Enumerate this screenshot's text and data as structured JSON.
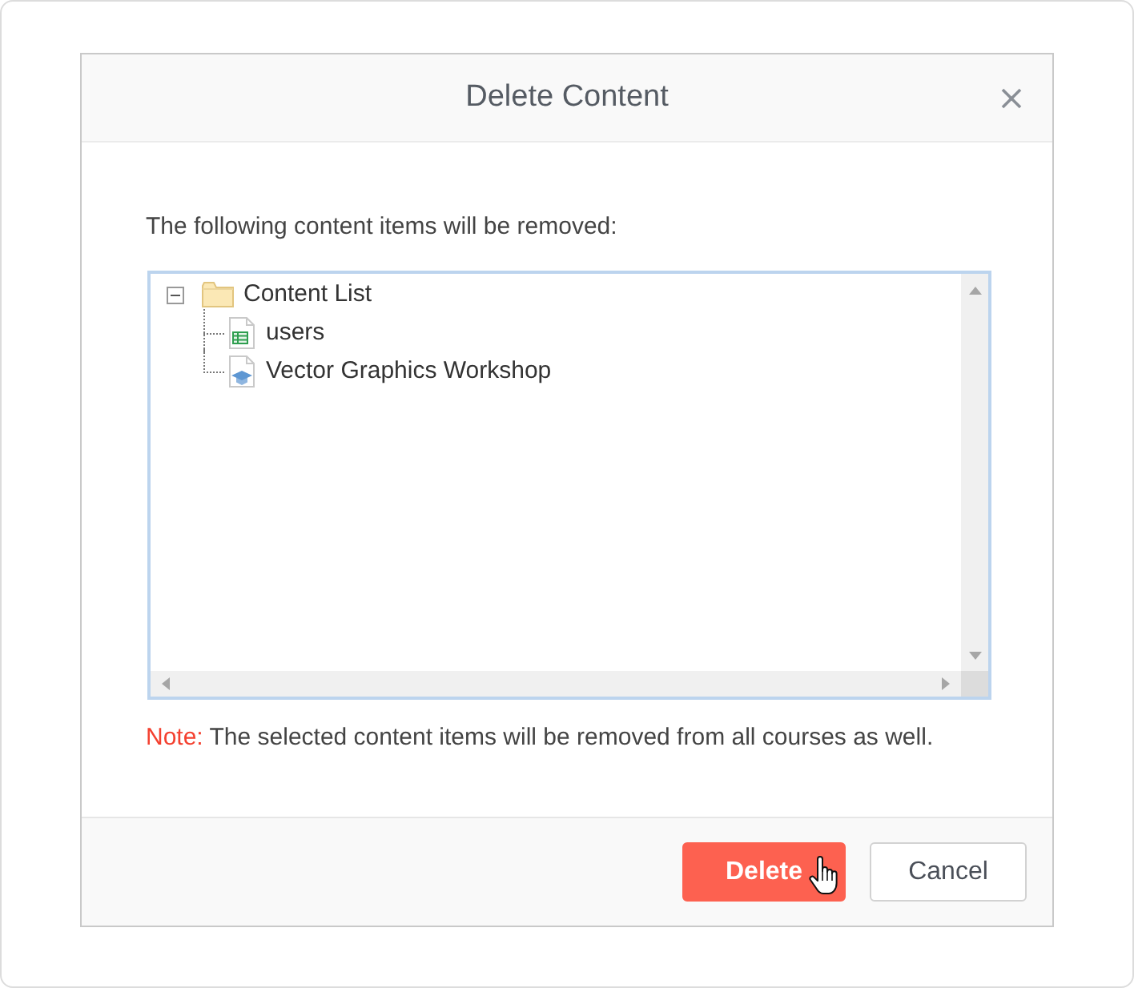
{
  "dialog": {
    "title": "Delete Content",
    "message": "The following content items will be removed:",
    "tree": {
      "items": [
        {
          "label": "Content List",
          "kind": "folder",
          "expanded": true,
          "children": [
            {
              "label": "users",
              "kind": "table"
            },
            {
              "label": "Vector Graphics Workshop",
              "kind": "course"
            }
          ]
        }
      ]
    },
    "note": {
      "label": "Note:",
      "text": "The selected content items will be removed from all courses as well."
    },
    "buttons": [
      {
        "label": "Delete",
        "kind": "danger",
        "hovered": true
      },
      {
        "label": "Cancel",
        "kind": "secondary",
        "hovered": false
      }
    ]
  }
}
